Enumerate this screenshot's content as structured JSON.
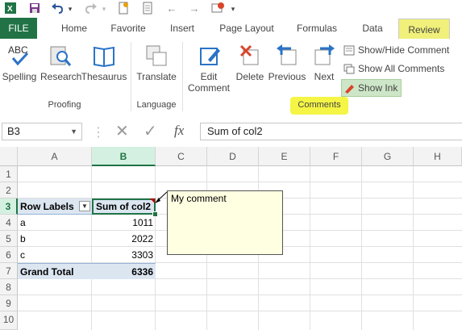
{
  "qat": {
    "icons": [
      "excel-icon",
      "save-icon",
      "undo-icon",
      "redo-icon",
      "new-icon",
      "open-icon",
      "back-icon",
      "forward-icon",
      "help-icon"
    ]
  },
  "tabs": [
    "FILE",
    "Home",
    "Favorite",
    "Insert",
    "Page Layout",
    "Formulas",
    "Data",
    "Review"
  ],
  "active_tab": "Review",
  "ribbon": {
    "proofing": {
      "spelling": "Spelling",
      "research": "Research",
      "thesaurus": "Thesaurus",
      "label": "Proofing"
    },
    "language": {
      "translate": "Translate",
      "label": "Language"
    },
    "comments": {
      "edit_line1": "Edit",
      "edit_line2": "Comment",
      "delete": "Delete",
      "previous": "Previous",
      "next": "Next",
      "show_hide": "Show/Hide Comment",
      "show_all": "Show All Comments",
      "show_ink": "Show Ink",
      "label": "Comments"
    },
    "abc_text": "ABC",
    "translate_glyph": "a",
    "translate_glyph2": "あ"
  },
  "formula_bar": {
    "name_box": "B3",
    "fx": "fx",
    "formula": "Sum of col2"
  },
  "grid": {
    "columns": [
      "A",
      "B",
      "C",
      "D",
      "E",
      "F",
      "G",
      "H"
    ],
    "rows": [
      "1",
      "2",
      "3",
      "4",
      "5",
      "6",
      "7",
      "8",
      "9",
      "10"
    ],
    "selected_cell": "B3"
  },
  "pivot": {
    "row_labels_header": "Row Labels",
    "value_header": "Sum of col2",
    "rows": [
      {
        "label": "a",
        "value": "1011"
      },
      {
        "label": "b",
        "value": "2022"
      },
      {
        "label": "c",
        "value": "3303"
      }
    ],
    "total_label": "Grand Total",
    "total_value": "6336"
  },
  "comment": {
    "text": "My comment"
  },
  "colors": {
    "accent": "#217346",
    "highlight": "#f5f545",
    "pivot_header": "#dce6f1",
    "comment_bg": "#ffffe1"
  }
}
